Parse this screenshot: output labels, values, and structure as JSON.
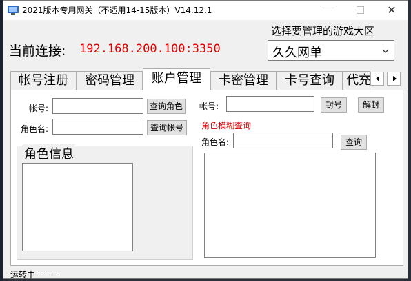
{
  "window": {
    "title": "2021版本专用网关（不适用14-15版本）V14.12.1",
    "close_glyph": "✕"
  },
  "header": {
    "connection_label": "当前连接:",
    "connection_value": "192.168.200.100:3350",
    "region_label": "选择要管理的游戏大区",
    "region_selected": "久久网单"
  },
  "tabs": [
    {
      "label": "帐号注册"
    },
    {
      "label": "密码管理"
    },
    {
      "label": "账户管理"
    },
    {
      "label": "卡密管理"
    },
    {
      "label": "卡号查询"
    },
    {
      "label": "代充"
    }
  ],
  "account_panel": {
    "account_label": "帐号:",
    "account_value": "",
    "query_role_button": "查询角色",
    "role_name_label": "角色名:",
    "role_name_value": "",
    "query_account_button": "查询帐号",
    "role_info_title": "角色信息",
    "right_account_label": "帐号:",
    "right_account_value": "",
    "ban_button": "封号",
    "unban_button": "解封",
    "fuzzy_title": "角色模糊查询",
    "fuzzy_role_label": "角色名:",
    "fuzzy_role_value": "",
    "fuzzy_query_button": "查询"
  },
  "status": {
    "text": "运转中 - - - -"
  },
  "colors": {
    "connection_value": "#e00000",
    "fuzzy_title": "#d00000"
  }
}
